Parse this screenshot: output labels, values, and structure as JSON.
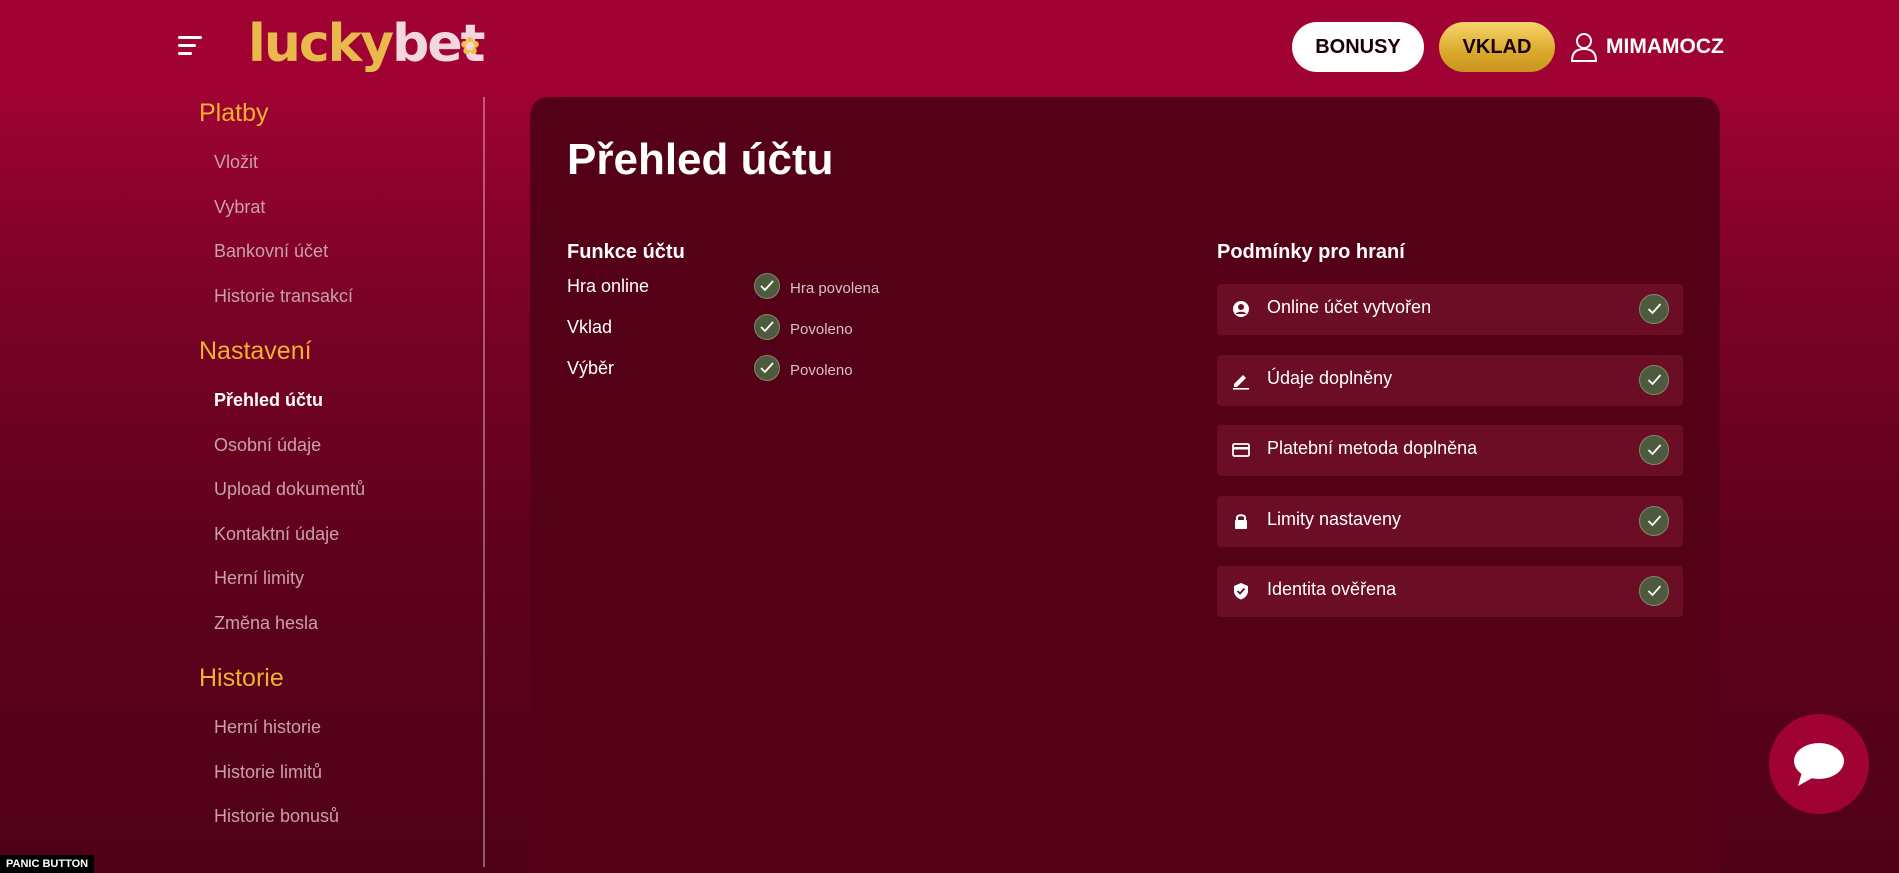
{
  "header": {
    "logo_part1": "lucky",
    "logo_part2": "bet",
    "bonusy_label": "BONUSY",
    "vklad_label": "VKLAD",
    "username": "MIMAMOCZ"
  },
  "sidebar": {
    "sections": [
      {
        "title": "Platby",
        "items": [
          "Vložit",
          "Vybrat",
          "Bankovní účet",
          "Historie transakcí"
        ]
      },
      {
        "title": "Nastavení",
        "items": [
          "Přehled účtu",
          "Osobní údaje",
          "Upload dokumentů",
          "Kontaktní údaje",
          "Herní limity",
          "Změna hesla"
        ]
      },
      {
        "title": "Historie",
        "items": [
          "Herní historie",
          "Historie limitů",
          "Historie bonusů"
        ]
      }
    ],
    "active_item": "Přehled účtu"
  },
  "main": {
    "title": "Přehled účtu",
    "features_title": "Funkce účtu",
    "features": [
      {
        "label": "Hra online",
        "status": "Hra povolena"
      },
      {
        "label": "Vklad",
        "status": "Povoleno"
      },
      {
        "label": "Výběr",
        "status": "Povoleno"
      }
    ],
    "conditions_title": "Podmínky pro hraní",
    "conditions": [
      {
        "icon": "user-circle-icon",
        "label": "Online účet vytvořen"
      },
      {
        "icon": "pencil-icon",
        "label": "Údaje doplněny"
      },
      {
        "icon": "credit-card-icon",
        "label": "Platební metoda doplněna"
      },
      {
        "icon": "lock-icon",
        "label": "Limity nastaveny"
      },
      {
        "icon": "shield-check-icon",
        "label": "Identita ověřena"
      }
    ]
  },
  "panic_label": "PANIC BUTTON",
  "colors": {
    "header_bg": "#a00233",
    "accent_gold": "#f0b030",
    "panel_bg": "#540016",
    "check_bg": "#4e5a3e"
  }
}
